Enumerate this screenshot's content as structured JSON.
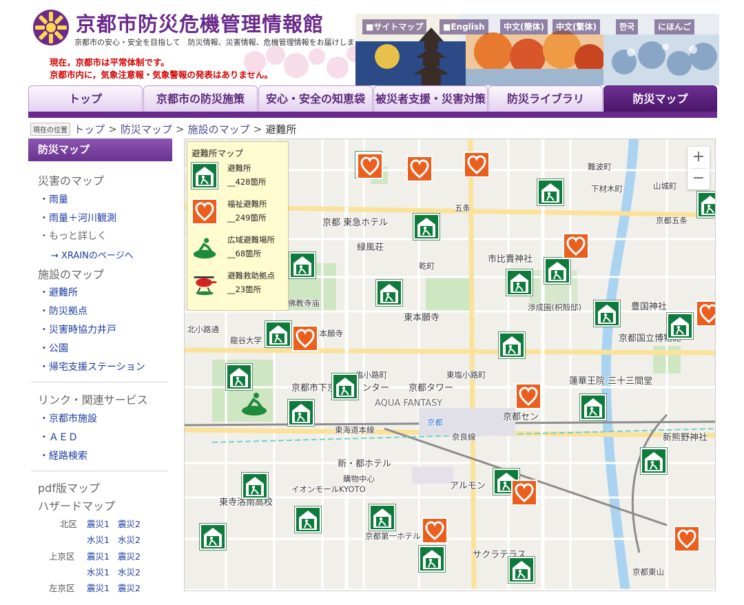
{
  "site": {
    "title": "京都市防災危機管理情報館",
    "tagline": "京都市の安心・安全を目指して　防災情報、災害情報、危機管理情報をお届けします。",
    "status_line1": "現在，京都市は平常体制です。",
    "status_line2": "京都市内に，気象注意報・気象警報の発表はありません。"
  },
  "top_links": [
    "■サイトマップ",
    "■English",
    "中文(簡体)",
    "中文(繁体)",
    "한국",
    "にほんご"
  ],
  "nav": {
    "tabs": [
      "トップ",
      "京都市の防災施策",
      "安心・安全の知恵袋",
      "被災者支援・災害対策",
      "防災ライブラリ",
      "防災マップ"
    ],
    "active": "防災マップ"
  },
  "breadcrumb": {
    "label": "現在の位置",
    "items": [
      "トップ",
      "防災マップ",
      "施設のマップ",
      "避難所"
    ],
    "separator": ">"
  },
  "sidebar": {
    "heading": "防災マップ",
    "disaster_map_heading": "災害のマップ",
    "disaster_items": [
      "・雨量",
      "・雨量＋河川観測",
      "・もっと詳しく"
    ],
    "xrain_link": "→ XRAINのページへ",
    "facility_map_heading": "施設のマップ",
    "facility_items": [
      "・避難所",
      "・防災拠点",
      "・災害時協力井戸",
      "・公園",
      "・帰宅支援ステーション"
    ],
    "links_heading": "リンク・関連サービス",
    "links_items": [
      "・京都市施設",
      "・ＡＥＤ",
      "・経路検索"
    ],
    "pdf_heading": "pdf版マップ",
    "hazard_heading": "ハザードマップ",
    "hazard": [
      {
        "ward": "北区",
        "quake1": "震災1",
        "quake2": "震災2",
        "flood1": "水災1",
        "flood2": "水災2"
      },
      {
        "ward": "上京区",
        "quake1": "震災1",
        "quake2": "震災2",
        "flood1": "水災1",
        "flood2": "水災2"
      },
      {
        "ward": "左京区",
        "quake1": "震災1",
        "quake2": "震災2"
      }
    ]
  },
  "legend": {
    "title": "避難所マップ",
    "items": [
      {
        "name": "避難所",
        "count": "__428箇所",
        "icon": "shelter-icon"
      },
      {
        "name": "福祉避難所",
        "count": "__249箇所",
        "icon": "welfare-shelter-icon"
      },
      {
        "name": "広域避難場所",
        "count": "__68箇所",
        "icon": "wide-area-evacuation-icon"
      },
      {
        "name": "避難救助拠点",
        "count": "__23箇所",
        "icon": "rescue-base-icon"
      }
    ]
  },
  "map": {
    "zoom_in": "+",
    "zoom_out": "−",
    "labels": [
      "京都 東急ホテル",
      "緑風荘",
      "市比賣神社",
      "佛教寺庙",
      "渉成園(枳殻邸)",
      "豊国神社",
      "東本願寺",
      "龍谷大学",
      "京都国立博物館",
      "京都市下京",
      "ンター",
      "京都タワー",
      "AQUA FANTASY",
      "蓮華王院 三十三間堂",
      "京都セン",
      "京都",
      "東海道本線",
      "奈良線",
      "新・都ホテル",
      "購物中心",
      "イオンモールKYOTO",
      "アルモン",
      "東寺洛南高校",
      "京都第一ホテル",
      "サクラテラス",
      "新熊野神社",
      "京都五条",
      "五条",
      "北小路通",
      "西本願寺",
      "難波町",
      "山城町",
      "下材木町",
      "乾町",
      "塩小路町",
      "東塩小路町",
      "京都東山"
    ]
  }
}
